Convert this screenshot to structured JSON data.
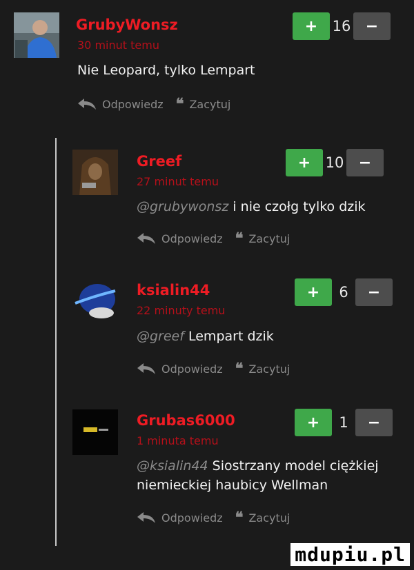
{
  "actions": {
    "reply_label": "Odpowiedz",
    "quote_label": "Zacytuj"
  },
  "comments": [
    {
      "username": "GrubyWonsz",
      "time": "30 minut temu",
      "mention": "",
      "text": "Nie Leopard, tylko Lempart",
      "score": "16",
      "avatar_icon": "user-photo-avatar"
    },
    {
      "username": "Greef",
      "time": "27 minut temu",
      "mention": "@grubywonsz",
      "text": " i nie czołg tylko dzik",
      "score": "10",
      "avatar_icon": "hooded-figure-avatar"
    },
    {
      "username": "ksialin44",
      "time": "22 minuty temu",
      "mention": "@greef",
      "text": " Lempart dzik",
      "score": "6",
      "avatar_icon": "domestos-bottle-avatar"
    },
    {
      "username": "Grubas6000",
      "time": "1 minuta temu",
      "mention": "@ksialin44",
      "text": " Siostrzany model ciężkiej niemieckiej haubicy Wellman",
      "score": "1",
      "avatar_icon": "black-game-avatar"
    }
  ],
  "colors": {
    "username": "#ee1c24",
    "time": "#b5101a",
    "plus": "#3fa84a",
    "minus": "#4d4d4d",
    "background": "#1b1b1b"
  },
  "watermark": "mdupiu.pl"
}
